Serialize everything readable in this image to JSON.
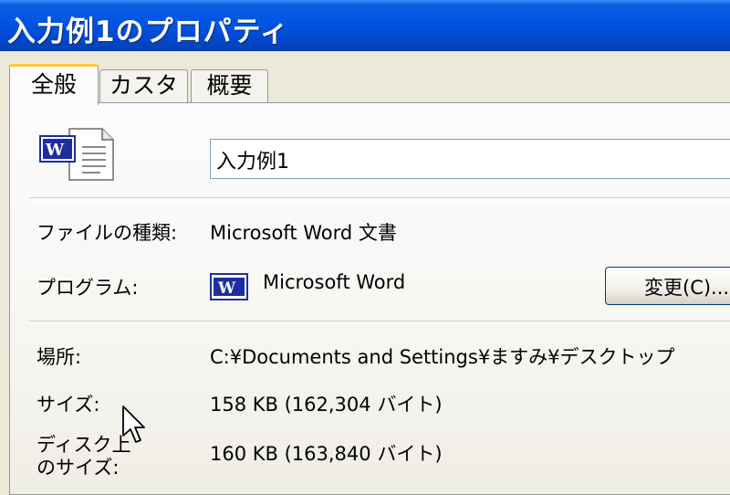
{
  "window": {
    "title": "入力例1のプロパティ"
  },
  "tabs": [
    {
      "label": "全般",
      "active": true
    },
    {
      "label": "カスタム",
      "active": false
    },
    {
      "label": "概要",
      "active": false
    }
  ],
  "general": {
    "file_icon": "word-document-icon",
    "name_value": "入力例1",
    "file_type_label": "ファイルの種類:",
    "file_type_value": "Microsoft Word 文書",
    "program_label": "プログラム:",
    "program_icon": "word-app-icon",
    "program_value": "Microsoft Word",
    "change_button_label": "変更(C)...",
    "location_label": "場所:",
    "location_value": "C:¥Documents and Settings¥ますみ¥デスクトップ",
    "size_label": "サイズ:",
    "size_value": "158 KB (162,304 バイト)",
    "disk_size_label_line1": "ディスク上",
    "disk_size_label_line2": "のサイズ:",
    "disk_size_value": "160 KB (163,840 バイト)"
  },
  "colors": {
    "titlebar": "#0054e3",
    "tab_highlight": "#ffc83c",
    "word_blue": "#1c2ea0"
  }
}
